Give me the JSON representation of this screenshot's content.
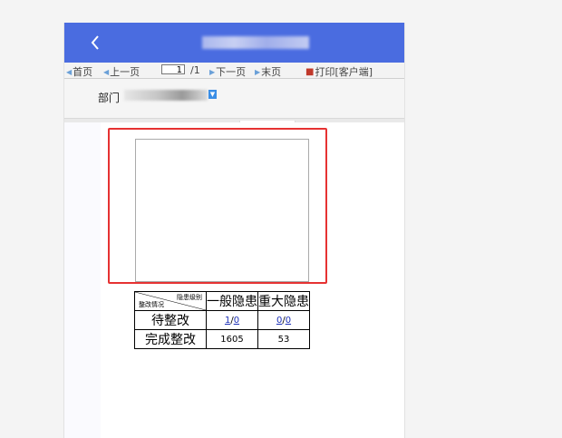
{
  "header": {
    "back_icon": "chevron-left-icon",
    "title": ""
  },
  "toolbar": {
    "first": "首页",
    "prev": "上一页",
    "page_value": "1",
    "page_total": "/1",
    "next": "下一页",
    "last": "末页",
    "print": "打印[客户端]",
    "tri_left": "◀",
    "tri_right": "▶",
    "print_icon": "printer-icon"
  },
  "filter": {
    "dept_label": "部门",
    "dropdown_icon": "chevron-down-icon"
  },
  "report": {
    "table": {
      "corner_top": "隐患级别",
      "corner_bottom": "整改情况",
      "col1": "一般隐患",
      "col2": "重大隐患",
      "rows": [
        {
          "label": "待整改",
          "c1a": "1",
          "sep1": "/",
          "c1b": "0",
          "c2a": "0",
          "sep2": "/",
          "c2b": "0"
        },
        {
          "label": "完成整改",
          "c1": "1605",
          "c2": "53"
        }
      ]
    }
  },
  "colors": {
    "topbar": "#4a6ce0",
    "highlight": "#e63232",
    "link": "#1b2fb7"
  }
}
